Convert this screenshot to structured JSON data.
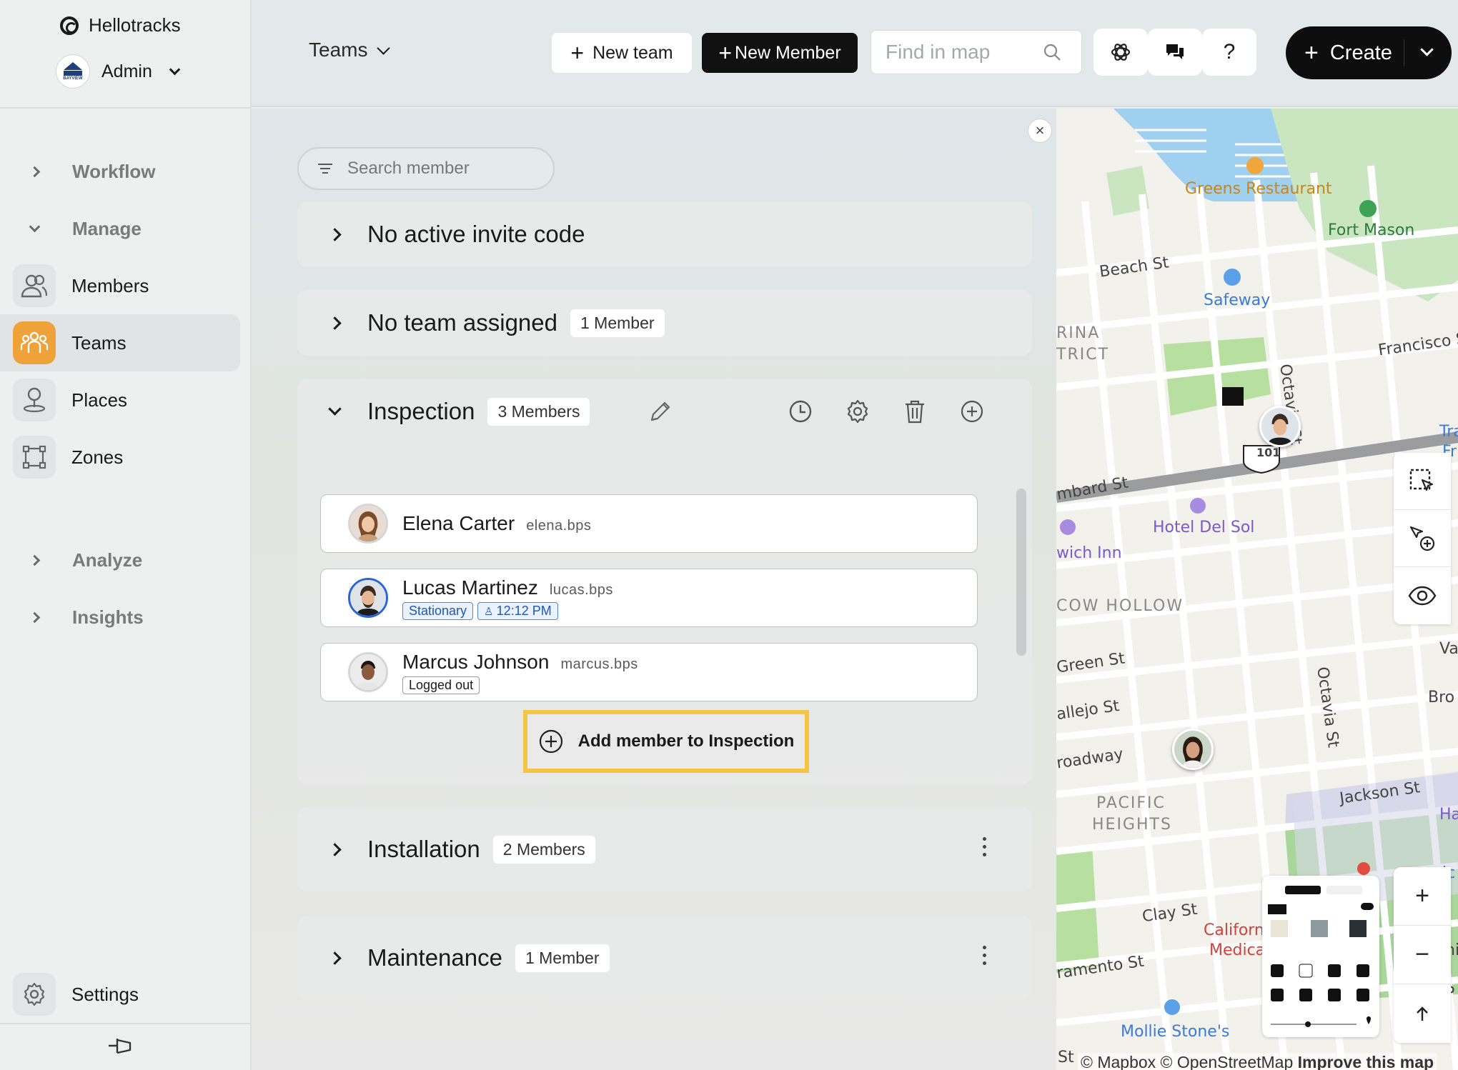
{
  "app": {
    "brand": "Hellotracks",
    "org_name": "Admin",
    "org_logo_text": "BAYVIEW"
  },
  "sidebar": {
    "sections": [
      {
        "label": "Workflow",
        "state": "collapsed"
      },
      {
        "label": "Manage",
        "state": "expanded"
      },
      {
        "label": "Analyze",
        "state": "collapsed"
      },
      {
        "label": "Insights",
        "state": "collapsed"
      }
    ],
    "items": [
      {
        "label": "Members",
        "icon": "members-icon"
      },
      {
        "label": "Teams",
        "icon": "teams-icon",
        "active": true
      },
      {
        "label": "Places",
        "icon": "places-icon"
      },
      {
        "label": "Zones",
        "icon": "zones-icon"
      }
    ],
    "settings_label": "Settings"
  },
  "topbar": {
    "view_label": "Teams",
    "new_team_label": "New team",
    "new_member_label": "New Member",
    "find_placeholder": "Find in map",
    "help_label": "?",
    "create_label": "Create"
  },
  "panel": {
    "search_placeholder": "Search member",
    "groups": [
      {
        "title": "No active invite code"
      },
      {
        "title": "No team assigned",
        "badge": "1 Member"
      },
      {
        "title": "Inspection",
        "badge": "3 Members"
      },
      {
        "title": "Installation",
        "badge": "2 Members"
      },
      {
        "title": "Maintenance",
        "badge": "1 Member"
      }
    ],
    "members": [
      {
        "name": "Elena Carter",
        "username": "elena.bps",
        "tags": []
      },
      {
        "name": "Lucas Martinez",
        "username": "lucas.bps",
        "tags": [
          "Stationary",
          "12:12 PM"
        ]
      },
      {
        "name": "Marcus Johnson",
        "username": "marcus.bps",
        "tags": [
          "Logged out"
        ]
      }
    ],
    "add_member_label": "Add member to Inspection"
  },
  "map": {
    "labels": {
      "greens": "Greens Restaurant",
      "fort_mason": "Fort Mason",
      "beach_st": "Beach St",
      "safeway": "Safeway",
      "marina": "RINA",
      "district": "TRICT",
      "francisco": "Francisco S",
      "octavia1": "Octavia St",
      "octavia2": "Octavia St",
      "lombard": "mbard St",
      "hwy": "101",
      "hotel": "Hotel Del Sol",
      "inn": "wich Inn",
      "cow_hollow": "COW HOLLOW",
      "green_st": "Green St",
      "vallejo": "allejo St",
      "broadway": "roadway",
      "bro": "Bro",
      "va": "Va",
      "pacific1": "PACIFIC",
      "pacific2": "HEIGHTS",
      "jackson": "Jackson St",
      "clay": "Clay St",
      "cal1": "Californ",
      "cal2": "Medica",
      "sacramento": "ramento St",
      "mollie": "Mollie Stone's",
      "st": "St",
      "tra": "Tra",
      "fr": "Fr",
      "ha": "Ha",
      "ic": "ic",
      "p": "P",
      "ni": "ni"
    },
    "zoom_in": "+",
    "zoom_out": "−",
    "attribution": "© Mapbox © OpenStreetMap",
    "improve": "Improve this map"
  }
}
